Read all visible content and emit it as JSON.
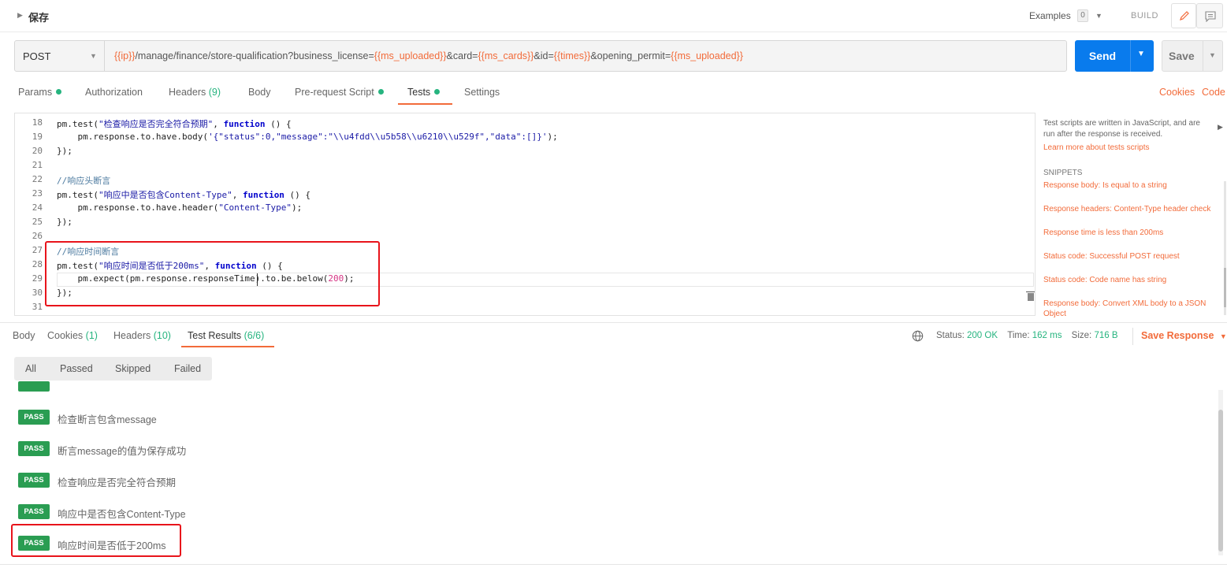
{
  "header": {
    "title": "保存",
    "examples_label": "Examples",
    "examples_count": "0",
    "build_label": "BUILD",
    "icons": [
      "pencil-icon",
      "comment-icon"
    ]
  },
  "request": {
    "method": "POST",
    "url_parts": [
      {
        "text": "{{ip}}",
        "var": true
      },
      {
        "text": "/manage/finance/store-qualification?business_license=",
        "var": false
      },
      {
        "text": "{{ms_uploaded}}",
        "var": true
      },
      {
        "text": "&card=",
        "var": false
      },
      {
        "text": "{{ms_cards}}",
        "var": true
      },
      {
        "text": "&id=",
        "var": false
      },
      {
        "text": "{{times}}",
        "var": true
      },
      {
        "text": "&opening_permit=",
        "var": false
      },
      {
        "text": "{{ms_uploaded}}",
        "var": true
      }
    ],
    "send_label": "Send",
    "save_label": "Save"
  },
  "request_tabs": [
    {
      "label": "Params",
      "dot": true
    },
    {
      "label": "Authorization"
    },
    {
      "label": "Headers",
      "count": "(9)"
    },
    {
      "label": "Body"
    },
    {
      "label": "Pre-request Script",
      "dot": true
    },
    {
      "label": "Tests",
      "dot": true,
      "active": true
    },
    {
      "label": "Settings"
    }
  ],
  "links": {
    "cookies": "Cookies",
    "code": "Code"
  },
  "editor": {
    "lines": [
      {
        "n": "18",
        "code": "pm.test(\"检查响应是否完全符合预期\", function () {"
      },
      {
        "n": "19",
        "code": "    pm.response.to.have.body('{\"status\":0,\"message\":\"\\\\u4fdd\\\\u5b58\\\\u6210\\\\u529f\",\"data\":[]}');"
      },
      {
        "n": "20",
        "code": "});"
      },
      {
        "n": "21",
        "code": ""
      },
      {
        "n": "22",
        "code": "//响应头断言"
      },
      {
        "n": "23",
        "code": "pm.test(\"响应中是否包含Content-Type\", function () {"
      },
      {
        "n": "24",
        "code": "    pm.response.to.have.header(\"Content-Type\");"
      },
      {
        "n": "25",
        "code": "});"
      },
      {
        "n": "26",
        "code": ""
      },
      {
        "n": "27",
        "code": "//响应时间断言"
      },
      {
        "n": "28",
        "code": "pm.test(\"响应时间是否低于200ms\", function () {"
      },
      {
        "n": "29",
        "code": "    pm.expect(pm.response.responseTime).to.be.below(200);"
      },
      {
        "n": "30",
        "code": "});"
      },
      {
        "n": "31",
        "code": ""
      }
    ]
  },
  "side_panel": {
    "description": "Test scripts are written in JavaScript, and are run after the response is received.",
    "learn_more": "Learn more about tests scripts",
    "snippets_heading": "SNIPPETS",
    "snippets": [
      "Response body: Is equal to a string",
      "Response headers: Content-Type header check",
      "Response time is less than 200ms",
      "Status code: Successful POST request",
      "Status code: Code name has string",
      "Response body: Convert XML body to a JSON Object"
    ]
  },
  "response": {
    "tabs": [
      {
        "label": "Body"
      },
      {
        "label": "Cookies",
        "count": "(1)"
      },
      {
        "label": "Headers",
        "count": "(10)"
      },
      {
        "label": "Test Results",
        "count": "(6/6)",
        "active": true
      }
    ],
    "status_label": "Status:",
    "status_value": "200 OK",
    "time_label": "Time:",
    "time_value": "162 ms",
    "size_label": "Size:",
    "size_value": "716 B",
    "save_response": "Save Response",
    "filters": [
      "All",
      "Passed",
      "Skipped",
      "Failed"
    ],
    "results": [
      {
        "badge": "PASS",
        "name": "检查断言包含message"
      },
      {
        "badge": "PASS",
        "name": "断言message的值为保存成功"
      },
      {
        "badge": "PASS",
        "name": "检查响应是否完全符合预期"
      },
      {
        "badge": "PASS",
        "name": "响应中是否包含Content-Type"
      },
      {
        "badge": "PASS",
        "name": "响应时间是否低于200ms"
      }
    ]
  },
  "colors": {
    "accent": "#f26b3a",
    "send": "#097bed",
    "pass": "#2a9d52",
    "status_ok": "#26b47f",
    "highlight_box": "#e8141b"
  }
}
